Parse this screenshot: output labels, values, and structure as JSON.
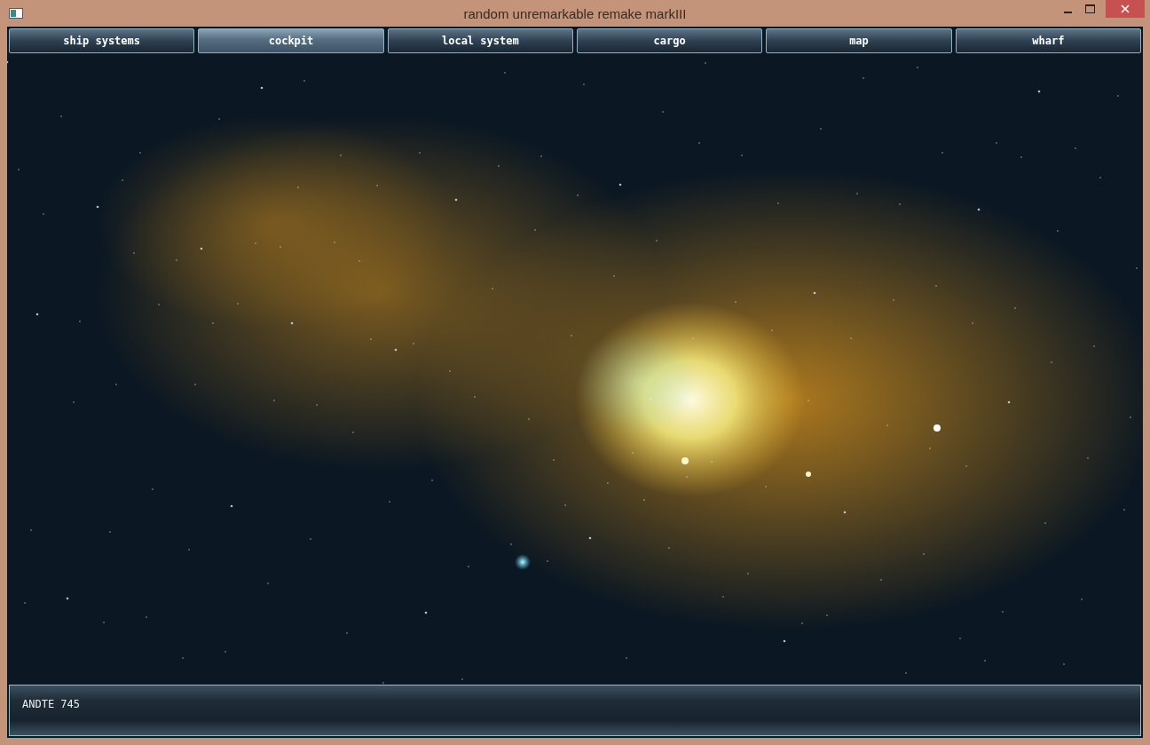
{
  "window": {
    "title": "random unremarkable remake markIII"
  },
  "tabs": [
    {
      "label": "ship systems",
      "selected": false
    },
    {
      "label": "cockpit",
      "selected": true
    },
    {
      "label": "local system",
      "selected": false
    },
    {
      "label": "cargo",
      "selected": false
    },
    {
      "label": "map",
      "selected": false
    },
    {
      "label": "wharf",
      "selected": false
    }
  ],
  "status_panel": {
    "text": "ANDTE 745"
  }
}
